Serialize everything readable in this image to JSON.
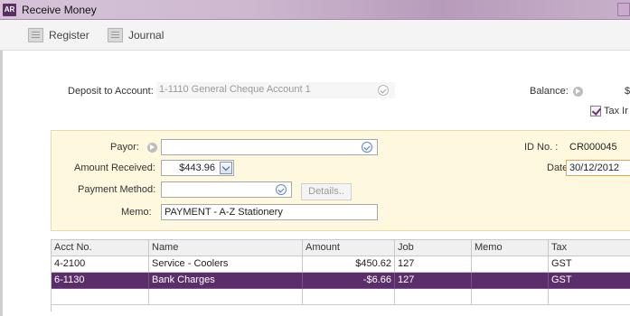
{
  "window": {
    "app_badge": "AR",
    "title": "Receive Money"
  },
  "toolbar": {
    "register_label": "Register",
    "journal_label": "Journal"
  },
  "deposit": {
    "label": "Deposit to Account:",
    "value": "1-1110 General Cheque Account 1",
    "balance_label": "Balance:",
    "balance_value": "$",
    "tax_inclusive_label": "Tax Ir",
    "tax_inclusive_checked": true
  },
  "payment": {
    "payor_label": "Payor:",
    "payor_value": "",
    "amount_label": "Amount Received:",
    "amount_value": "$443.96",
    "method_label": "Payment Method:",
    "method_value": "",
    "details_button": "Details..",
    "memo_label": "Memo:",
    "memo_value": "PAYMENT - A-Z Stationery",
    "id_label": "ID No. :",
    "id_value": "CR000045",
    "date_label": "Date:",
    "date_value": "30/12/2012"
  },
  "grid": {
    "headers": [
      "Acct No.",
      "Name",
      "Amount",
      "Job",
      "Memo",
      "Tax"
    ],
    "rows": [
      {
        "acct": "4-2100",
        "name": "Service - Coolers",
        "amount": "$450.62",
        "job": "127",
        "memo": "",
        "tax": "GST"
      },
      {
        "acct": "6-1130",
        "name": "Bank Charges",
        "amount": "-$6.66",
        "job": "127",
        "memo": "",
        "tax": "GST"
      },
      {
        "acct": "",
        "name": "",
        "amount": "",
        "job": "",
        "memo": "",
        "tax": ""
      }
    ],
    "selected_row": 1
  },
  "colors": {
    "accent": "#5b2d6b",
    "panel_background": "#fef9de"
  }
}
